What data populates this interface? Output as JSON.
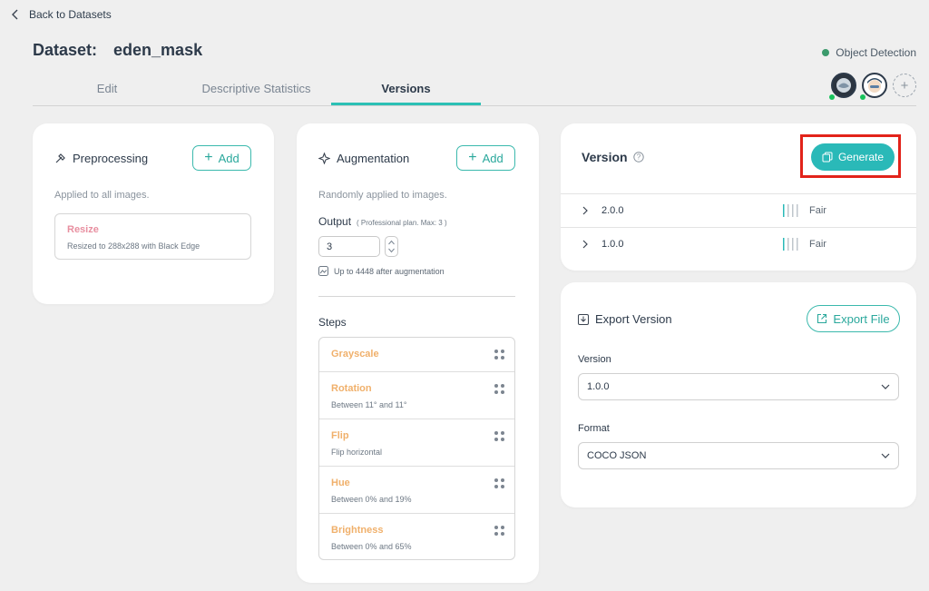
{
  "nav": {
    "back_label": "Back to Datasets"
  },
  "header": {
    "dataset_prefix": "Dataset:",
    "dataset_name": "eden_mask",
    "project_type": "Object Detection",
    "project_type_color": "#3b9a6c"
  },
  "tabs": [
    {
      "label": "Edit"
    },
    {
      "label": "Descriptive Statistics"
    },
    {
      "label": "Versions",
      "active": true
    }
  ],
  "accent_color": "#2cc0b5",
  "preprocessing": {
    "title": "Preprocessing",
    "add_label": "Add",
    "description": "Applied to all images.",
    "items": [
      {
        "name": "Resize",
        "detail": "Resized to 288x288 with Black Edge"
      }
    ]
  },
  "augmentation": {
    "title": "Augmentation",
    "add_label": "Add",
    "description": "Randomly applied to images.",
    "output_label": "Output",
    "output_note": "( Professional plan. Max: 3 )",
    "output_value": "3",
    "output_summary": "Up to 4448 after augmentation",
    "steps_label": "Steps",
    "steps": [
      {
        "name": "Grayscale",
        "detail": ""
      },
      {
        "name": "Rotation",
        "detail": "Between 11° and 11°"
      },
      {
        "name": "Flip",
        "detail": "Flip horizontal"
      },
      {
        "name": "Hue",
        "detail": "Between 0% and 19%"
      },
      {
        "name": "Brightness",
        "detail": "Between 0% and 65%"
      }
    ]
  },
  "versions": {
    "title": "Version",
    "generate_label": "Generate",
    "rows": [
      {
        "version": "2.0.0",
        "quality": "Fair"
      },
      {
        "version": "1.0.0",
        "quality": "Fair"
      }
    ]
  },
  "export": {
    "title": "Export Version",
    "export_label": "Export File",
    "version_label": "Version",
    "version_value": "1.0.0",
    "format_label": "Format",
    "format_value": "COCO JSON"
  }
}
